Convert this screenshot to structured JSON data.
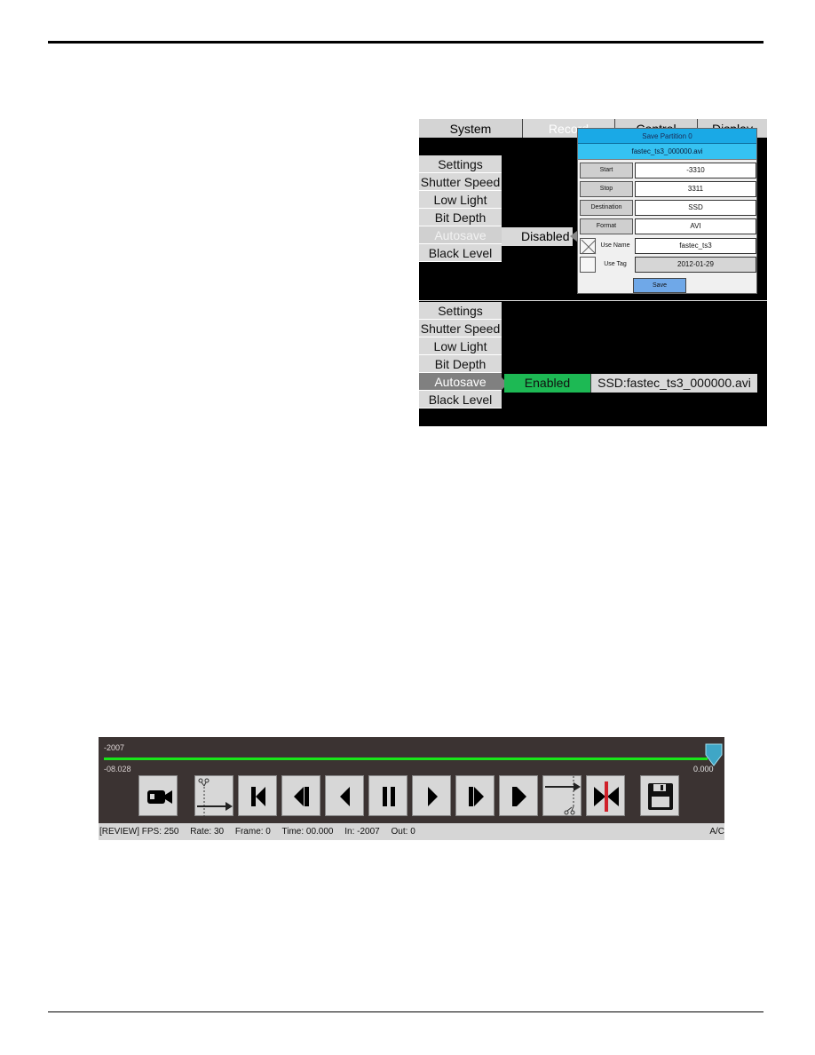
{
  "camera_screen": {
    "tabs": [
      {
        "label": "System",
        "active": false
      },
      {
        "label": "Record",
        "active": true
      },
      {
        "label": "Control",
        "active": false
      },
      {
        "label": "Display",
        "active": false
      }
    ],
    "menu_top": {
      "items": [
        "Settings",
        "Shutter Speed",
        "Low Light",
        "Bit Depth",
        "Autosave",
        "Black Level"
      ],
      "highlighted": "Autosave",
      "autosave_value": "Disabled"
    },
    "save_dialog": {
      "title": "Save Partition 0",
      "filename": "fastec_ts3_000000.avi",
      "fields": [
        {
          "label": "Start",
          "value": "-3310"
        },
        {
          "label": "Stop",
          "value": "3311"
        },
        {
          "label": "Destination",
          "value": "SSD"
        },
        {
          "label": "Format",
          "value": "AVI"
        }
      ],
      "use_name": {
        "label": "Use Name",
        "checked": true,
        "value": "fastec_ts3"
      },
      "use_tag": {
        "label": "Use Tag",
        "checked": false,
        "value": "2012-01-29"
      },
      "save_label": "Save"
    },
    "menu_bottom": {
      "items": [
        "Settings",
        "Shutter Speed",
        "Low Light",
        "Bit Depth",
        "Autosave",
        "Black Level"
      ],
      "selected": "Autosave",
      "autosave_value": "Enabled",
      "autosave_path": "SSD:fastec_ts3_000000.avi"
    },
    "colors": {
      "dialog_title": "#1aa9e6",
      "dialog_file": "#35c2f2",
      "enabled": "#1db954",
      "save_button": "#6fa8e8"
    }
  },
  "playback": {
    "top_label": "-2007",
    "left_time": "-08.028",
    "right_time": "0.000",
    "position_fraction": 1.0,
    "buttons": [
      {
        "name": "live-camera",
        "icon": "video-camera-icon"
      },
      {
        "name": "mark-in",
        "icon": "scissors-arrow-in-icon"
      },
      {
        "name": "go-to-start",
        "icon": "skip-to-start-icon"
      },
      {
        "name": "step-back",
        "icon": "step-backward-icon"
      },
      {
        "name": "play-reverse",
        "icon": "play-reverse-icon"
      },
      {
        "name": "pause",
        "icon": "pause-icon"
      },
      {
        "name": "play-forward",
        "icon": "play-icon"
      },
      {
        "name": "step-forward",
        "icon": "step-forward-icon"
      },
      {
        "name": "go-to-end",
        "icon": "skip-to-end-icon"
      },
      {
        "name": "mark-out",
        "icon": "scissors-arrow-out-icon"
      },
      {
        "name": "go-to-cut",
        "icon": "cut-point-icon"
      },
      {
        "name": "save",
        "icon": "floppy-disk-icon"
      }
    ],
    "status": {
      "mode": "[REVIEW] FPS: 250",
      "rate": "Rate: 30",
      "frame": "Frame: 0",
      "time": "Time: 00.000",
      "in": "In: -2007",
      "out": "Out: 0",
      "right": "A/C"
    },
    "colors": {
      "track": "#19e619",
      "cut_line": "#d0202a"
    }
  }
}
